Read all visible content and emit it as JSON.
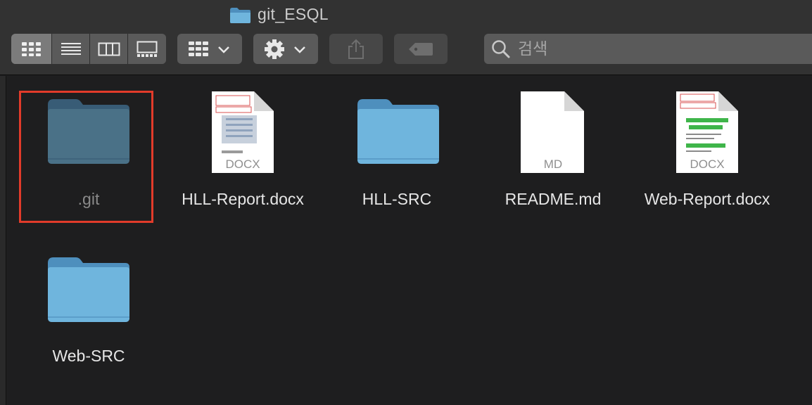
{
  "window": {
    "title": "git_ESQL"
  },
  "toolbar": {
    "view_modes": [
      "icon-view",
      "list-view",
      "column-view",
      "gallery-view"
    ],
    "active_view": "icon-view",
    "search": {
      "placeholder": "검색"
    }
  },
  "items": [
    {
      "name": ".git",
      "kind": "folder",
      "hidden": true,
      "selected": true
    },
    {
      "name": "HLL-Report.docx",
      "kind": "document",
      "tag": "DOCX"
    },
    {
      "name": "HLL-SRC",
      "kind": "folder"
    },
    {
      "name": "README.md",
      "kind": "document",
      "tag": "MD"
    },
    {
      "name": "Web-Report.docx",
      "kind": "document",
      "tag": "DOCX"
    },
    {
      "name": "Web-SRC",
      "kind": "folder"
    }
  ],
  "colors": {
    "folder_light": "#6fb5dd",
    "folder_dark": "#4e8fbd",
    "selection": "#e23b2a"
  }
}
